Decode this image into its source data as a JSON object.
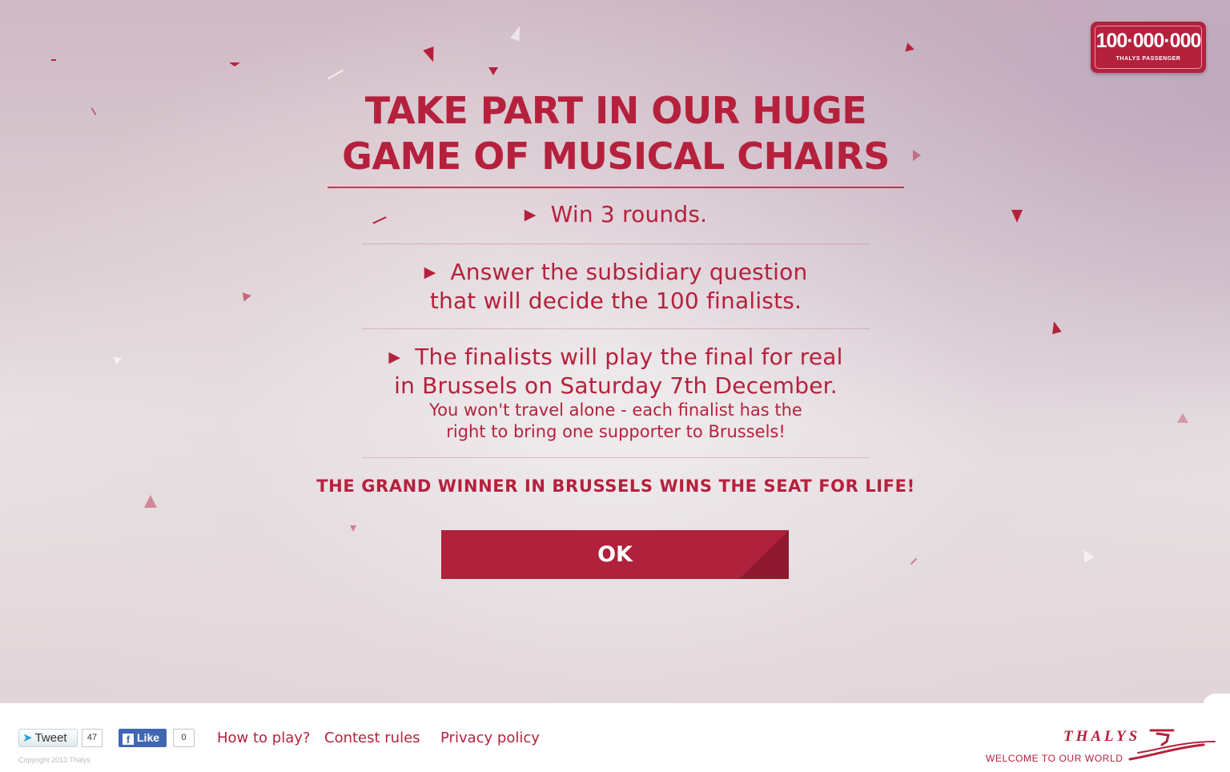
{
  "badge": {
    "number": "100·000·000",
    "subtitle": "THALYS PASSENGER"
  },
  "modal": {
    "title_line1": "TAKE PART IN OUR HUGE",
    "title_line2": "GAME OF MUSICAL CHAIRS",
    "steps": [
      {
        "line1": "Win 3 rounds."
      },
      {
        "line1": "Answer the subsidiary question",
        "line2": "that will decide the 100 finalists."
      },
      {
        "line1": "The finalists will play the final for real",
        "line2": "in Brussels on Saturday 7th December.",
        "note1": "You won't travel alone - each finalist has the",
        "note2": "right to bring one supporter to Brussels!"
      }
    ],
    "grand_winner": "THE GRAND WINNER IN BRUSSELS WINS THE SEAT FOR LIFE!",
    "ok_label": "OK"
  },
  "footer": {
    "tweet_label": "Tweet",
    "tweet_count": "47",
    "like_label": "Like",
    "like_count": "0",
    "copyright": "Copyright 2013 Thalys",
    "links": [
      "How to play?",
      "Contest rules",
      "Privacy policy"
    ],
    "brand": "THALYS",
    "tagline": "WELCOME TO OUR WORLD"
  },
  "colors": {
    "brand_red": "#b5213d",
    "button_red": "#b0213c",
    "facebook_blue": "#4267b2",
    "twitter_blue": "#2aa3e0"
  },
  "icons": [
    "triangle-bullet-icon",
    "twitter-bird-icon",
    "facebook-f-icon",
    "thalys-logo-mark-icon"
  ]
}
